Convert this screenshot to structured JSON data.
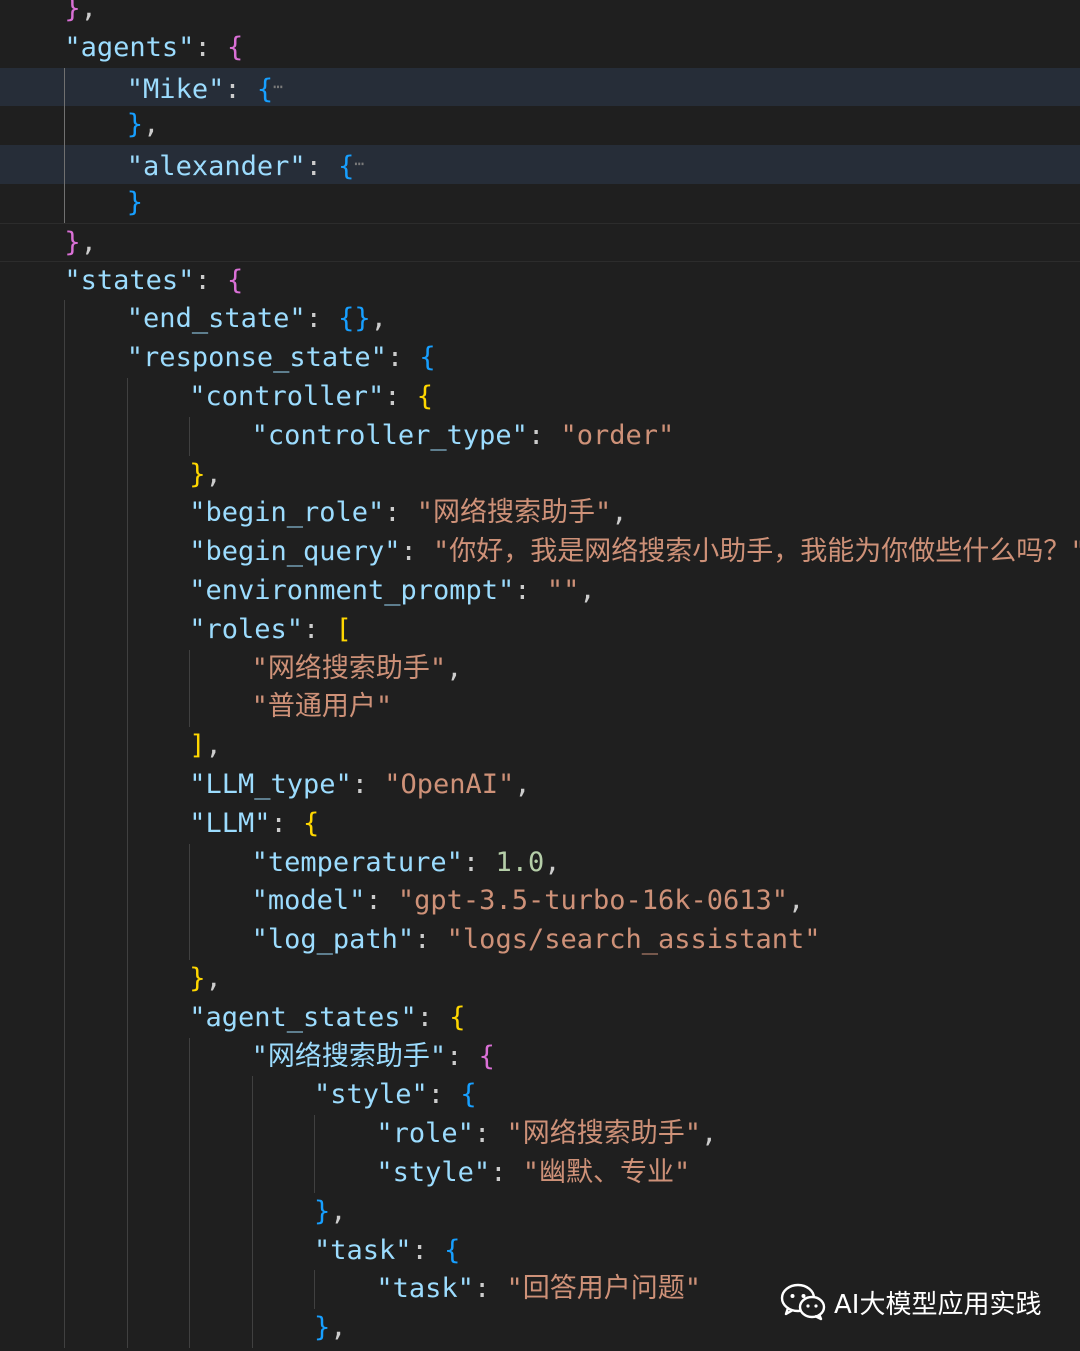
{
  "code_lines": [
    {
      "indent": 1,
      "tokens": [
        {
          "t": "}",
          "c": "b2"
        },
        {
          "t": ",",
          "c": "p"
        }
      ]
    },
    {
      "indent": 1,
      "tokens": [
        {
          "t": "\"agents\"",
          "c": "k"
        },
        {
          "t": ": ",
          "c": "p"
        },
        {
          "t": "{",
          "c": "b2"
        }
      ]
    },
    {
      "indent": 2,
      "highlight": true,
      "folded": true,
      "tokens": [
        {
          "t": "\"Mike\"",
          "c": "k"
        },
        {
          "t": ": ",
          "c": "p"
        },
        {
          "t": "{",
          "c": "b3"
        }
      ]
    },
    {
      "indent": 2,
      "tokens": [
        {
          "t": "}",
          "c": "b3"
        },
        {
          "t": ",",
          "c": "p"
        }
      ]
    },
    {
      "indent": 2,
      "highlight": true,
      "folded": true,
      "tokens": [
        {
          "t": "\"alexander\"",
          "c": "k"
        },
        {
          "t": ": ",
          "c": "p"
        },
        {
          "t": "{",
          "c": "b3"
        }
      ]
    },
    {
      "indent": 2,
      "tokens": [
        {
          "t": "}",
          "c": "b3"
        }
      ]
    },
    {
      "indent": 1,
      "sep_top": true,
      "sep_bottom": true,
      "tokens": [
        {
          "t": "}",
          "c": "b2"
        },
        {
          "t": ",",
          "c": "p"
        }
      ]
    },
    {
      "indent": 1,
      "tokens": [
        {
          "t": "\"states\"",
          "c": "k"
        },
        {
          "t": ": ",
          "c": "p"
        },
        {
          "t": "{",
          "c": "b2"
        }
      ]
    },
    {
      "indent": 2,
      "tokens": [
        {
          "t": "\"end_state\"",
          "c": "k"
        },
        {
          "t": ": ",
          "c": "p"
        },
        {
          "t": "{}",
          "c": "b3"
        },
        {
          "t": ",",
          "c": "p"
        }
      ]
    },
    {
      "indent": 2,
      "tokens": [
        {
          "t": "\"response_state\"",
          "c": "k"
        },
        {
          "t": ": ",
          "c": "p"
        },
        {
          "t": "{",
          "c": "b3"
        }
      ]
    },
    {
      "indent": 3,
      "tokens": [
        {
          "t": "\"controller\"",
          "c": "k"
        },
        {
          "t": ": ",
          "c": "p"
        },
        {
          "t": "{",
          "c": "b1"
        }
      ]
    },
    {
      "indent": 4,
      "tokens": [
        {
          "t": "\"controller_type\"",
          "c": "k"
        },
        {
          "t": ": ",
          "c": "p"
        },
        {
          "t": "\"order\"",
          "c": "s"
        }
      ]
    },
    {
      "indent": 3,
      "tokens": [
        {
          "t": "}",
          "c": "b1"
        },
        {
          "t": ",",
          "c": "p"
        }
      ]
    },
    {
      "indent": 3,
      "tokens": [
        {
          "t": "\"begin_role\"",
          "c": "k"
        },
        {
          "t": ": ",
          "c": "p"
        },
        {
          "t": "\"网络搜索助手\"",
          "c": "s"
        },
        {
          "t": ",",
          "c": "p"
        }
      ]
    },
    {
      "indent": 3,
      "tokens": [
        {
          "t": "\"begin_query\"",
          "c": "k"
        },
        {
          "t": ": ",
          "c": "p"
        },
        {
          "t": "\"你好，我是网络搜索小助手，我能为你做些什么吗？\"",
          "c": "s"
        },
        {
          "t": ",",
          "c": "p"
        }
      ]
    },
    {
      "indent": 3,
      "tokens": [
        {
          "t": "\"environment_prompt\"",
          "c": "k"
        },
        {
          "t": ": ",
          "c": "p"
        },
        {
          "t": "\"\"",
          "c": "s"
        },
        {
          "t": ",",
          "c": "p"
        }
      ]
    },
    {
      "indent": 3,
      "tokens": [
        {
          "t": "\"roles\"",
          "c": "k"
        },
        {
          "t": ": ",
          "c": "p"
        },
        {
          "t": "[",
          "c": "b1"
        }
      ]
    },
    {
      "indent": 4,
      "tokens": [
        {
          "t": "\"网络搜索助手\"",
          "c": "s"
        },
        {
          "t": ",",
          "c": "p"
        }
      ]
    },
    {
      "indent": 4,
      "tokens": [
        {
          "t": "\"普通用户\"",
          "c": "s"
        }
      ]
    },
    {
      "indent": 3,
      "tokens": [
        {
          "t": "]",
          "c": "b1"
        },
        {
          "t": ",",
          "c": "p"
        }
      ]
    },
    {
      "indent": 3,
      "tokens": [
        {
          "t": "\"LLM_type\"",
          "c": "k"
        },
        {
          "t": ": ",
          "c": "p"
        },
        {
          "t": "\"OpenAI\"",
          "c": "s"
        },
        {
          "t": ",",
          "c": "p"
        }
      ]
    },
    {
      "indent": 3,
      "tokens": [
        {
          "t": "\"LLM\"",
          "c": "k"
        },
        {
          "t": ": ",
          "c": "p"
        },
        {
          "t": "{",
          "c": "b1"
        }
      ]
    },
    {
      "indent": 4,
      "tokens": [
        {
          "t": "\"temperature\"",
          "c": "k"
        },
        {
          "t": ": ",
          "c": "p"
        },
        {
          "t": "1.0",
          "c": "n"
        },
        {
          "t": ",",
          "c": "p"
        }
      ]
    },
    {
      "indent": 4,
      "tokens": [
        {
          "t": "\"model\"",
          "c": "k"
        },
        {
          "t": ": ",
          "c": "p"
        },
        {
          "t": "\"gpt-3.5-turbo-16k-0613\"",
          "c": "s"
        },
        {
          "t": ",",
          "c": "p"
        }
      ]
    },
    {
      "indent": 4,
      "tokens": [
        {
          "t": "\"log_path\"",
          "c": "k"
        },
        {
          "t": ": ",
          "c": "p"
        },
        {
          "t": "\"logs/search_assistant\"",
          "c": "s"
        }
      ]
    },
    {
      "indent": 3,
      "tokens": [
        {
          "t": "}",
          "c": "b1"
        },
        {
          "t": ",",
          "c": "p"
        }
      ]
    },
    {
      "indent": 3,
      "tokens": [
        {
          "t": "\"agent_states\"",
          "c": "k"
        },
        {
          "t": ": ",
          "c": "p"
        },
        {
          "t": "{",
          "c": "b1"
        }
      ]
    },
    {
      "indent": 4,
      "tokens": [
        {
          "t": "\"网络搜索助手\"",
          "c": "k"
        },
        {
          "t": ": ",
          "c": "p"
        },
        {
          "t": "{",
          "c": "b2"
        }
      ]
    },
    {
      "indent": 5,
      "tokens": [
        {
          "t": "\"style\"",
          "c": "k"
        },
        {
          "t": ": ",
          "c": "p"
        },
        {
          "t": "{",
          "c": "b3"
        }
      ]
    },
    {
      "indent": 6,
      "tokens": [
        {
          "t": "\"role\"",
          "c": "k"
        },
        {
          "t": ": ",
          "c": "p"
        },
        {
          "t": "\"网络搜索助手\"",
          "c": "s"
        },
        {
          "t": ",",
          "c": "p"
        }
      ]
    },
    {
      "indent": 6,
      "tokens": [
        {
          "t": "\"style\"",
          "c": "k"
        },
        {
          "t": ": ",
          "c": "p"
        },
        {
          "t": "\"幽默、专业\"",
          "c": "s"
        }
      ]
    },
    {
      "indent": 5,
      "tokens": [
        {
          "t": "}",
          "c": "b3"
        },
        {
          "t": ",",
          "c": "p"
        }
      ]
    },
    {
      "indent": 5,
      "tokens": [
        {
          "t": "\"task\"",
          "c": "k"
        },
        {
          "t": ": ",
          "c": "p"
        },
        {
          "t": "{",
          "c": "b3"
        }
      ]
    },
    {
      "indent": 6,
      "tokens": [
        {
          "t": "\"task\"",
          "c": "k"
        },
        {
          "t": ": ",
          "c": "p"
        },
        {
          "t": "\"回答用户问题\"",
          "c": "s"
        }
      ]
    },
    {
      "indent": 5,
      "tokens": [
        {
          "t": "}",
          "c": "b3"
        },
        {
          "t": ",",
          "c": "p"
        }
      ]
    }
  ],
  "fold_ellipsis": "⋯",
  "watermark": {
    "text": "AI大模型应用实践",
    "icon": "wechat-icon"
  }
}
